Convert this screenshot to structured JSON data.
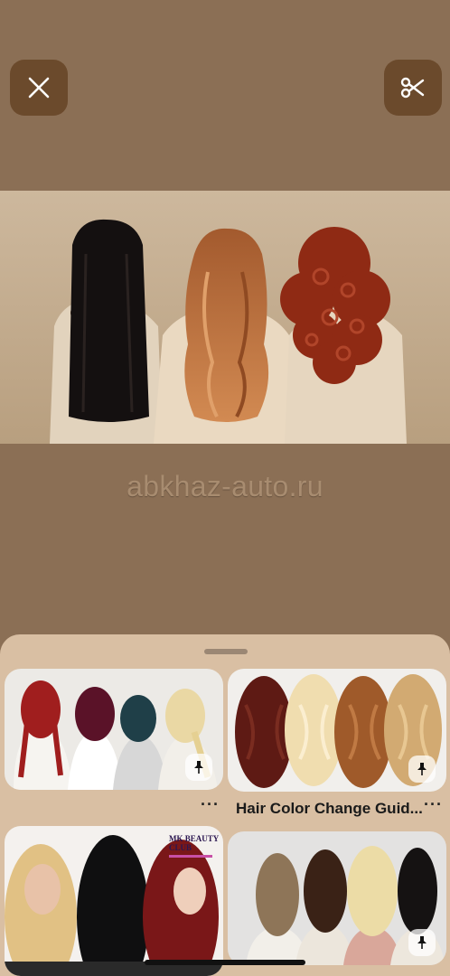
{
  "toolbar": {
    "close_icon": "close-icon",
    "scissors_icon": "scissors-icon"
  },
  "image": {
    "source_text": "abkhaz-auto.ru"
  },
  "related_pins": [
    {
      "title": "",
      "more_label": "···"
    },
    {
      "title": "Hair Color Change Guid...",
      "more_label": "···"
    },
    {
      "title": "",
      "logo_text": "MK BEAUTY CLUB"
    },
    {
      "title": ""
    }
  ],
  "colors": {
    "background": "#8b6f55",
    "button": "#6b4a2c",
    "sheet": "#d9bfa3"
  }
}
